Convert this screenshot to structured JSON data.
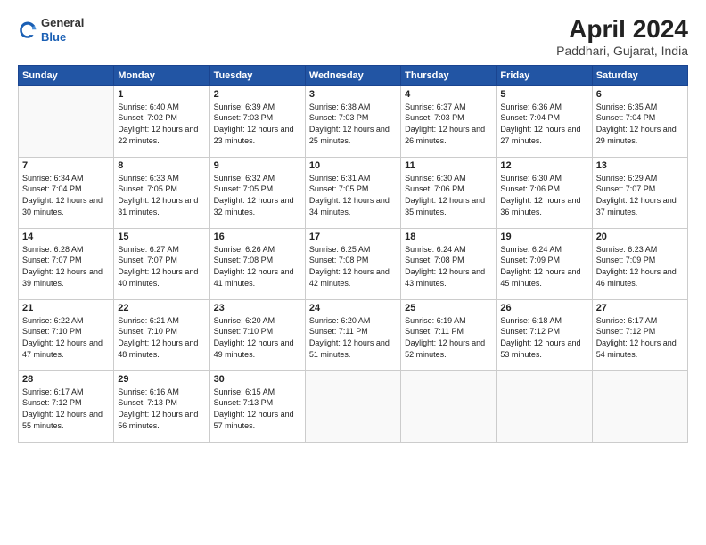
{
  "logo": {
    "general": "General",
    "blue": "Blue"
  },
  "title": "April 2024",
  "subtitle": "Paddhari, Gujarat, India",
  "weekdays": [
    "Sunday",
    "Monday",
    "Tuesday",
    "Wednesday",
    "Thursday",
    "Friday",
    "Saturday"
  ],
  "weeks": [
    [
      {
        "num": "",
        "sunrise": "",
        "sunset": "",
        "daylight": ""
      },
      {
        "num": "1",
        "sunrise": "Sunrise: 6:40 AM",
        "sunset": "Sunset: 7:02 PM",
        "daylight": "Daylight: 12 hours and 22 minutes."
      },
      {
        "num": "2",
        "sunrise": "Sunrise: 6:39 AM",
        "sunset": "Sunset: 7:03 PM",
        "daylight": "Daylight: 12 hours and 23 minutes."
      },
      {
        "num": "3",
        "sunrise": "Sunrise: 6:38 AM",
        "sunset": "Sunset: 7:03 PM",
        "daylight": "Daylight: 12 hours and 25 minutes."
      },
      {
        "num": "4",
        "sunrise": "Sunrise: 6:37 AM",
        "sunset": "Sunset: 7:03 PM",
        "daylight": "Daylight: 12 hours and 26 minutes."
      },
      {
        "num": "5",
        "sunrise": "Sunrise: 6:36 AM",
        "sunset": "Sunset: 7:04 PM",
        "daylight": "Daylight: 12 hours and 27 minutes."
      },
      {
        "num": "6",
        "sunrise": "Sunrise: 6:35 AM",
        "sunset": "Sunset: 7:04 PM",
        "daylight": "Daylight: 12 hours and 29 minutes."
      }
    ],
    [
      {
        "num": "7",
        "sunrise": "Sunrise: 6:34 AM",
        "sunset": "Sunset: 7:04 PM",
        "daylight": "Daylight: 12 hours and 30 minutes."
      },
      {
        "num": "8",
        "sunrise": "Sunrise: 6:33 AM",
        "sunset": "Sunset: 7:05 PM",
        "daylight": "Daylight: 12 hours and 31 minutes."
      },
      {
        "num": "9",
        "sunrise": "Sunrise: 6:32 AM",
        "sunset": "Sunset: 7:05 PM",
        "daylight": "Daylight: 12 hours and 32 minutes."
      },
      {
        "num": "10",
        "sunrise": "Sunrise: 6:31 AM",
        "sunset": "Sunset: 7:05 PM",
        "daylight": "Daylight: 12 hours and 34 minutes."
      },
      {
        "num": "11",
        "sunrise": "Sunrise: 6:30 AM",
        "sunset": "Sunset: 7:06 PM",
        "daylight": "Daylight: 12 hours and 35 minutes."
      },
      {
        "num": "12",
        "sunrise": "Sunrise: 6:30 AM",
        "sunset": "Sunset: 7:06 PM",
        "daylight": "Daylight: 12 hours and 36 minutes."
      },
      {
        "num": "13",
        "sunrise": "Sunrise: 6:29 AM",
        "sunset": "Sunset: 7:07 PM",
        "daylight": "Daylight: 12 hours and 37 minutes."
      }
    ],
    [
      {
        "num": "14",
        "sunrise": "Sunrise: 6:28 AM",
        "sunset": "Sunset: 7:07 PM",
        "daylight": "Daylight: 12 hours and 39 minutes."
      },
      {
        "num": "15",
        "sunrise": "Sunrise: 6:27 AM",
        "sunset": "Sunset: 7:07 PM",
        "daylight": "Daylight: 12 hours and 40 minutes."
      },
      {
        "num": "16",
        "sunrise": "Sunrise: 6:26 AM",
        "sunset": "Sunset: 7:08 PM",
        "daylight": "Daylight: 12 hours and 41 minutes."
      },
      {
        "num": "17",
        "sunrise": "Sunrise: 6:25 AM",
        "sunset": "Sunset: 7:08 PM",
        "daylight": "Daylight: 12 hours and 42 minutes."
      },
      {
        "num": "18",
        "sunrise": "Sunrise: 6:24 AM",
        "sunset": "Sunset: 7:08 PM",
        "daylight": "Daylight: 12 hours and 43 minutes."
      },
      {
        "num": "19",
        "sunrise": "Sunrise: 6:24 AM",
        "sunset": "Sunset: 7:09 PM",
        "daylight": "Daylight: 12 hours and 45 minutes."
      },
      {
        "num": "20",
        "sunrise": "Sunrise: 6:23 AM",
        "sunset": "Sunset: 7:09 PM",
        "daylight": "Daylight: 12 hours and 46 minutes."
      }
    ],
    [
      {
        "num": "21",
        "sunrise": "Sunrise: 6:22 AM",
        "sunset": "Sunset: 7:10 PM",
        "daylight": "Daylight: 12 hours and 47 minutes."
      },
      {
        "num": "22",
        "sunrise": "Sunrise: 6:21 AM",
        "sunset": "Sunset: 7:10 PM",
        "daylight": "Daylight: 12 hours and 48 minutes."
      },
      {
        "num": "23",
        "sunrise": "Sunrise: 6:20 AM",
        "sunset": "Sunset: 7:10 PM",
        "daylight": "Daylight: 12 hours and 49 minutes."
      },
      {
        "num": "24",
        "sunrise": "Sunrise: 6:20 AM",
        "sunset": "Sunset: 7:11 PM",
        "daylight": "Daylight: 12 hours and 51 minutes."
      },
      {
        "num": "25",
        "sunrise": "Sunrise: 6:19 AM",
        "sunset": "Sunset: 7:11 PM",
        "daylight": "Daylight: 12 hours and 52 minutes."
      },
      {
        "num": "26",
        "sunrise": "Sunrise: 6:18 AM",
        "sunset": "Sunset: 7:12 PM",
        "daylight": "Daylight: 12 hours and 53 minutes."
      },
      {
        "num": "27",
        "sunrise": "Sunrise: 6:17 AM",
        "sunset": "Sunset: 7:12 PM",
        "daylight": "Daylight: 12 hours and 54 minutes."
      }
    ],
    [
      {
        "num": "28",
        "sunrise": "Sunrise: 6:17 AM",
        "sunset": "Sunset: 7:12 PM",
        "daylight": "Daylight: 12 hours and 55 minutes."
      },
      {
        "num": "29",
        "sunrise": "Sunrise: 6:16 AM",
        "sunset": "Sunset: 7:13 PM",
        "daylight": "Daylight: 12 hours and 56 minutes."
      },
      {
        "num": "30",
        "sunrise": "Sunrise: 6:15 AM",
        "sunset": "Sunset: 7:13 PM",
        "daylight": "Daylight: 12 hours and 57 minutes."
      },
      {
        "num": "",
        "sunrise": "",
        "sunset": "",
        "daylight": ""
      },
      {
        "num": "",
        "sunrise": "",
        "sunset": "",
        "daylight": ""
      },
      {
        "num": "",
        "sunrise": "",
        "sunset": "",
        "daylight": ""
      },
      {
        "num": "",
        "sunrise": "",
        "sunset": "",
        "daylight": ""
      }
    ]
  ]
}
